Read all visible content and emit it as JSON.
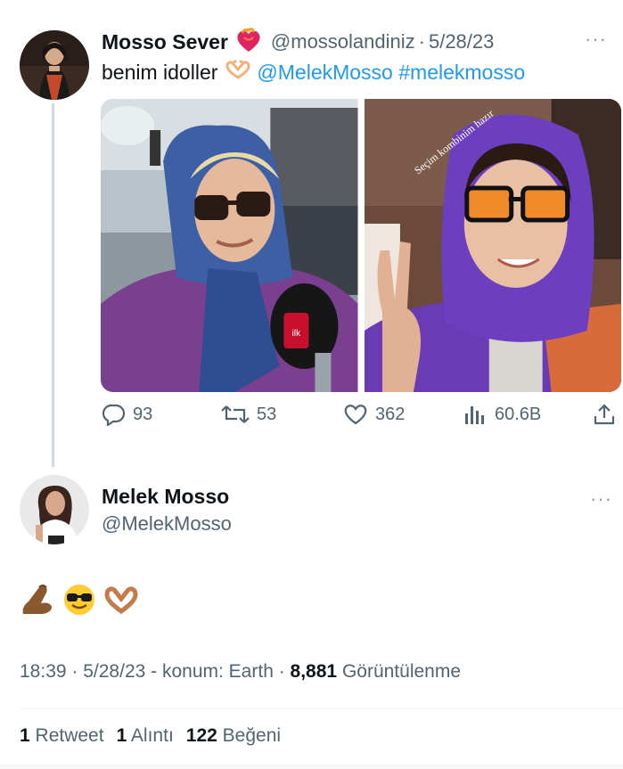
{
  "tweet1": {
    "display_name": "Mosso Sever",
    "handle": "@mossolandiniz",
    "separator": "·",
    "date": "5/28/23",
    "more": "···",
    "text_prefix": "benim idoller",
    "mention": "@MelekMosso",
    "hashtag": "#melekmosso",
    "media": {
      "right_photo_caption": "Seçim kombinim hazır",
      "mic_brand": "ilk"
    },
    "actions": {
      "replies": "93",
      "retweets": "53",
      "likes": "362",
      "views": "60.6B"
    }
  },
  "tweet2": {
    "display_name": "Melek Mosso",
    "handle": "@MelekMosso",
    "more": "···",
    "emojis": [
      "pinched-fingers",
      "smiling-face-with-sunglasses",
      "heart-hands"
    ],
    "meta": {
      "time": "18:39",
      "sep1": " · ",
      "date": "5/28/23",
      "location": " - konum: Earth",
      "sep2": " · ",
      "views_count": "8,881",
      "views_label": " Görüntülenme"
    },
    "stats": {
      "retweet_count": "1",
      "retweet_label": " Retweet",
      "quote_count": "1",
      "quote_label": " Alıntı",
      "like_count": "122",
      "like_label": " Beğeni"
    }
  },
  "colors": {
    "text": "#0f1419",
    "secondary": "#536471",
    "link": "#1d9bf0",
    "thread_line": "#cfd9de"
  }
}
